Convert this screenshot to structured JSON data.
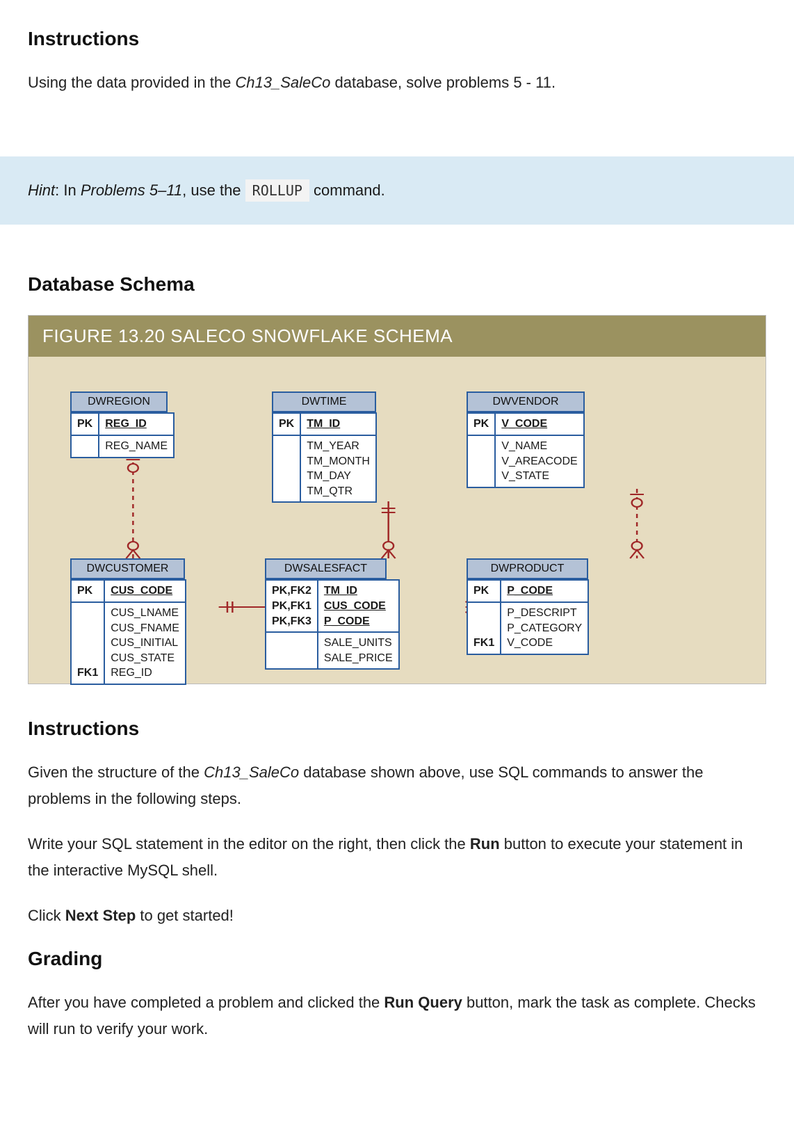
{
  "sections": {
    "instr1_heading": "Instructions",
    "instr1_text_pre": "Using the data provided in the ",
    "instr1_db": "Ch13_SaleCo",
    "instr1_text_post": " database, solve problems 5 - 11.",
    "hint_label": "Hint",
    "hint_pre": ": In ",
    "hint_problems": "Problems 5–11",
    "hint_mid": ", use the ",
    "hint_code": "ROLLUP",
    "hint_post": " command.",
    "schema_heading": "Database Schema",
    "figure_title": "FIGURE 13.20  SALECO SNOWFLAKE SCHEMA",
    "instr2_heading": "Instructions",
    "instr2_p1_pre": "Given the structure of the ",
    "instr2_p1_db": "Ch13_SaleCo",
    "instr2_p1_post": " database shown above, use SQL commands to answer the problems in the following steps.",
    "instr2_p2_pre": "Write your SQL statement in the editor on the right, then click the ",
    "instr2_p2_bold": "Run",
    "instr2_p2_post": " button to execute your statement in the interactive MySQL shell.",
    "instr2_p3_pre": "Click ",
    "instr2_p3_bold": "Next Step",
    "instr2_p3_post": " to get started!",
    "grading_heading": "Grading",
    "grading_p_pre": "After you have completed a problem and clicked the ",
    "grading_p_bold": "Run Query",
    "grading_p_post": " button, mark the task as complete. Checks will run to verify your work."
  },
  "entities": {
    "dwregion": {
      "name": "DWREGION",
      "pk_label": "PK",
      "pk": "REG_ID",
      "attrs": "REG_NAME"
    },
    "dwtime": {
      "name": "DWTIME",
      "pk_label": "PK",
      "pk": "TM_ID",
      "attrs": "TM_YEAR\nTM_MONTH\nTM_DAY\nTM_QTR"
    },
    "dwvendor": {
      "name": "DWVENDOR",
      "pk_label": "PK",
      "pk": "V_CODE",
      "attrs": "V_NAME\nV_AREACODE\nV_STATE"
    },
    "dwcustomer": {
      "name": "DWCUSTOMER",
      "pk_label": "PK",
      "pk": "CUS_CODE",
      "fk_label": "FK1",
      "attrs": "CUS_LNAME\nCUS_FNAME\nCUS_INITIAL\nCUS_STATE\nREG_ID"
    },
    "dwsalesfact": {
      "name": "DWSALESFACT",
      "k1": "PK,FK2",
      "k2": "PK,FK1",
      "k3": "PK,FK3",
      "pk1": "TM_ID",
      "pk2": "CUS_CODE",
      "pk3": "P_CODE",
      "attrs": "SALE_UNITS\nSALE_PRICE"
    },
    "dwproduct": {
      "name": "DWPRODUCT",
      "pk_label": "PK",
      "pk": "P_CODE",
      "fk_label": "FK1",
      "attrs": "P_DESCRIPT\nP_CATEGORY\nV_CODE"
    }
  }
}
